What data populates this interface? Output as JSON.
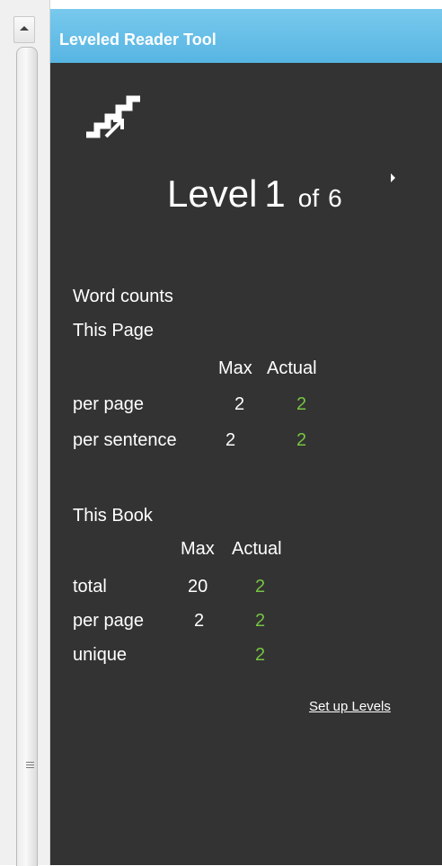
{
  "panel": {
    "title": "Leveled Reader Tool",
    "icon": "stairs-icon"
  },
  "level": {
    "label": "Level",
    "current": "1",
    "of_label": "of",
    "total": "6"
  },
  "word_counts": {
    "heading": "Word counts",
    "this_page": {
      "heading": "This Page",
      "col_max": "Max",
      "col_actual": "Actual",
      "rows": [
        {
          "label": "per page",
          "max": "2",
          "actual": "2"
        },
        {
          "label": "per sentence",
          "max": "2",
          "actual": "2"
        }
      ]
    },
    "this_book": {
      "heading": "This Book",
      "col_max": "Max",
      "col_actual": "Actual",
      "rows": [
        {
          "label": "total",
          "max": "20",
          "actual": "2"
        },
        {
          "label": "per page",
          "max": "2",
          "actual": "2"
        },
        {
          "label": "unique",
          "max": "",
          "actual": "2"
        }
      ]
    }
  },
  "setup_link": "Set up Levels",
  "colors": {
    "panel_bg": "#333333",
    "title_bar": "#5ab8e4",
    "actual_green": "#76c442"
  }
}
